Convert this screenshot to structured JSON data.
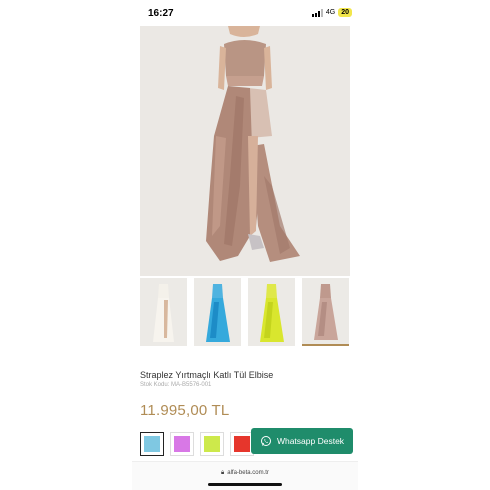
{
  "status_bar": {
    "time": "16:27",
    "network": "4G",
    "battery": "20"
  },
  "product": {
    "title": "Straplez Yırtmaçlı Katlı Tül Elbise",
    "sku_label": "Stok Kodu:",
    "sku_value": "MA-B5576-001",
    "price": "11.995,00 TL"
  },
  "thumbnails": [
    {
      "color": "#f4f1ea",
      "accent": "#e8e2d4"
    },
    {
      "color": "#35a9dc",
      "accent": "#1d8cc7"
    },
    {
      "color": "#d9e62e",
      "accent": "#c4d41d"
    },
    {
      "color": "#c9a59a",
      "accent": "#b48e84"
    }
  ],
  "swatches": [
    {
      "color": "#7fc8e2"
    },
    {
      "color": "#d878e6"
    },
    {
      "color": "#cde94b"
    },
    {
      "color": "#e6362c"
    }
  ],
  "whatsapp": {
    "label": "Whatsapp Destek",
    "color": "#1f8c6b"
  },
  "browser": {
    "url": "alfa-beta.com.tr"
  }
}
